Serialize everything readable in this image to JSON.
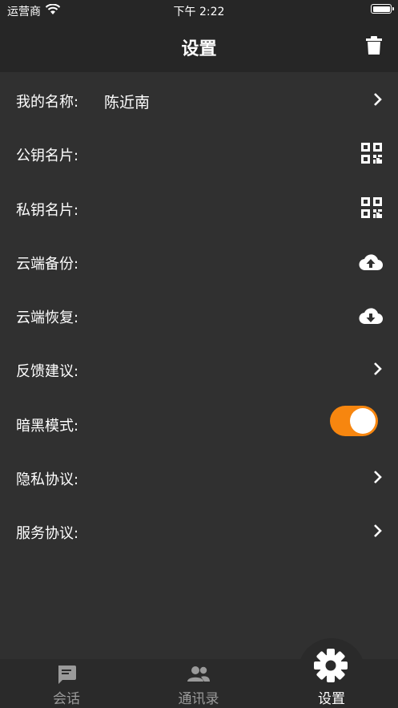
{
  "status_bar": {
    "carrier": "运营商",
    "time": "下午 2:22"
  },
  "nav": {
    "title": "设置"
  },
  "settings": {
    "name_label": "我的名称:",
    "name_value": "陈近南",
    "public_card_label": "公钥名片:",
    "private_card_label": "私钥名片:",
    "cloud_backup_label": "云端备份:",
    "cloud_restore_label": "云端恢复:",
    "feedback_label": "反馈建议:",
    "dark_mode_label": "暗黑模式:",
    "dark_mode_on": true,
    "privacy_label": "隐私协议:",
    "service_label": "服务协议:"
  },
  "tabs": [
    {
      "label": "会话",
      "icon": "chat-icon"
    },
    {
      "label": "通讯录",
      "icon": "contacts-icon"
    },
    {
      "label": "设置",
      "icon": "gear-icon",
      "active": true
    }
  ],
  "colors": {
    "accent": "#f7860f",
    "background": "#303030",
    "bar": "#262626"
  }
}
